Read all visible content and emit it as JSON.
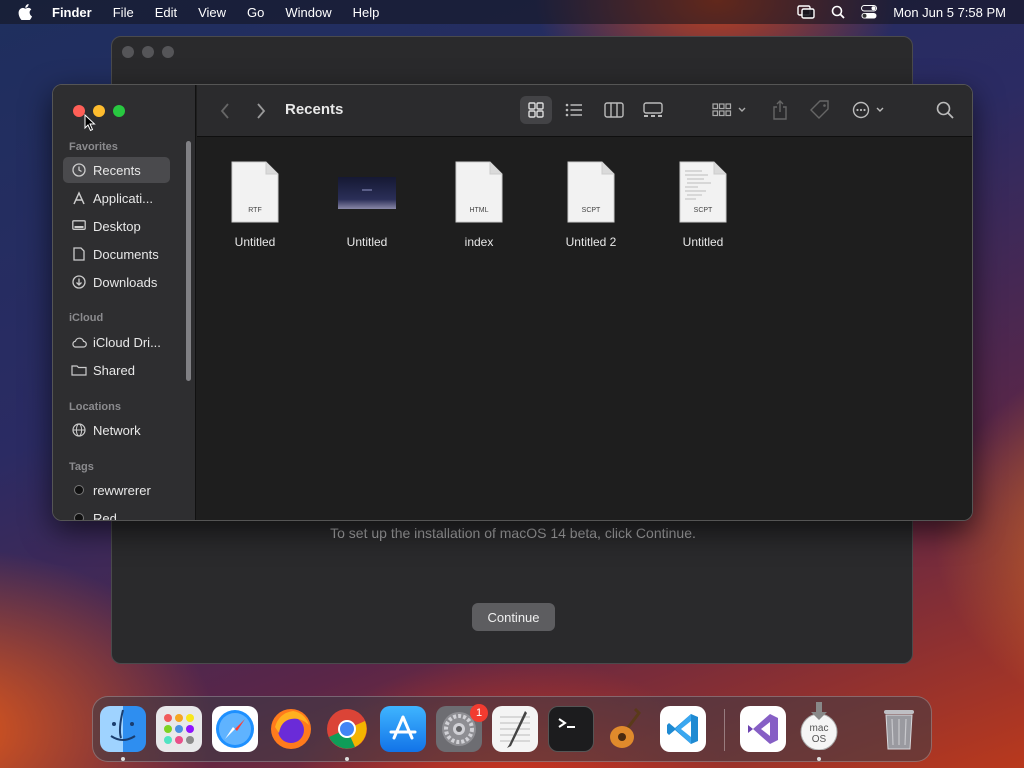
{
  "menubar": {
    "app": "Finder",
    "items": [
      "File",
      "Edit",
      "View",
      "Go",
      "Window",
      "Help"
    ],
    "datetime": "Mon Jun 5  7:58 PM",
    "icons": [
      "apple-icon",
      "screen-mirroring-icon",
      "spotlight-search-icon",
      "control-center-icon"
    ]
  },
  "installer": {
    "message": "To set up the installation of macOS 14 beta, click Continue.",
    "continue_label": "Continue"
  },
  "finder": {
    "title": "Recents",
    "sections": {
      "favorites": "Favorites",
      "icloud": "iCloud",
      "locations": "Locations",
      "tags": "Tags"
    },
    "favorites": [
      {
        "label": "Recents",
        "icon": "clock-icon",
        "active": true
      },
      {
        "label": "Applicati...",
        "icon": "applications-icon"
      },
      {
        "label": "Desktop",
        "icon": "desktop-icon"
      },
      {
        "label": "Documents",
        "icon": "document-icon"
      },
      {
        "label": "Downloads",
        "icon": "download-icon"
      }
    ],
    "icloud": [
      {
        "label": "iCloud Dri...",
        "icon": "cloud-icon"
      },
      {
        "label": "Shared",
        "icon": "shared-folder-icon"
      }
    ],
    "locations": [
      {
        "label": "Network",
        "icon": "globe-icon"
      }
    ],
    "tags": [
      {
        "label": "rewwrerer",
        "color": "#111111"
      },
      {
        "label": "Red",
        "color": "#111111"
      }
    ],
    "files": [
      {
        "name": "Untitled",
        "type_label": "RTF"
      },
      {
        "name": "Untitled",
        "type_label": ""
      },
      {
        "name": "index",
        "type_label": "HTML"
      },
      {
        "name": "Untitled 2",
        "type_label": "SCPT"
      },
      {
        "name": "Untitled",
        "type_label": "SCPT"
      }
    ]
  },
  "dock": {
    "apps": [
      "Finder",
      "Launchpad",
      "Safari",
      "Firefox",
      "Google Chrome",
      "App Store",
      "System Settings",
      "TextEdit",
      "Terminal",
      "GarageBand",
      "Visual Studio Code",
      "Visual Studio",
      "Install macOS",
      "Trash"
    ],
    "settings_badge": "1",
    "installer_label": "mac OS"
  },
  "colors": {
    "accent_red": "#ff5f57",
    "accent_yellow": "#febc2e",
    "accent_green": "#28c840"
  }
}
